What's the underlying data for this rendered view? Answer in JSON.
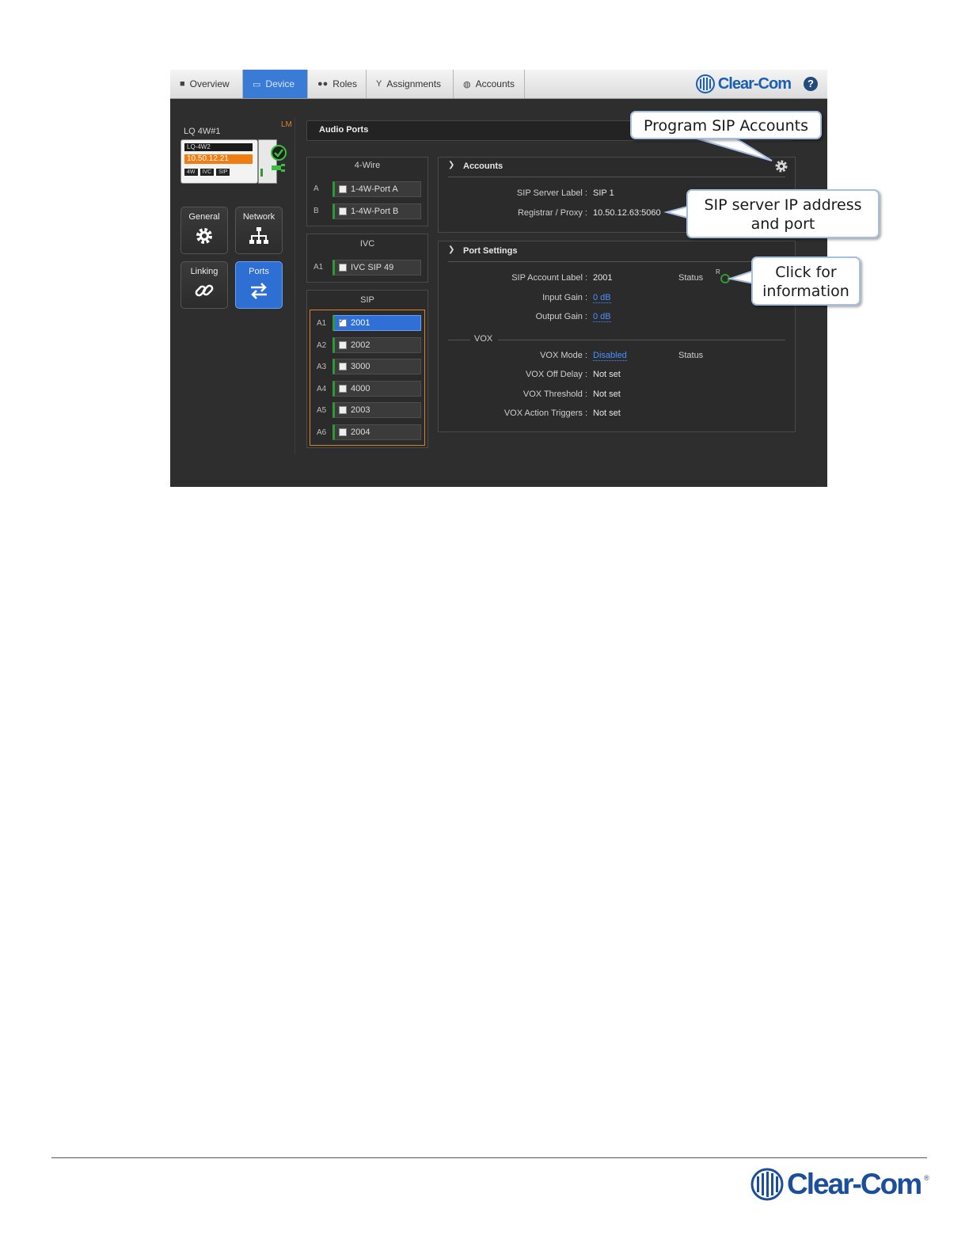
{
  "tabs": [
    {
      "label": "Overview",
      "icon": "grid-icon"
    },
    {
      "label": "Device",
      "icon": "device-icon"
    },
    {
      "label": "Roles",
      "icon": "users-icon"
    },
    {
      "label": "Assignments",
      "icon": "antenna-icon"
    },
    {
      "label": "Accounts",
      "icon": "globe-icon"
    }
  ],
  "active_tab": "Device",
  "brand": "Clear-Com",
  "help_label": "?",
  "device": {
    "name": "LQ 4W#1",
    "lm_badge": "LM",
    "card_name": "LQ-4W2",
    "ip": "10.50.12.21",
    "chips": [
      "4W",
      "IVC",
      "SIP"
    ]
  },
  "side_buttons": [
    {
      "label": "General",
      "icon": "gear-icon"
    },
    {
      "label": "Network",
      "icon": "network-icon"
    },
    {
      "label": "Linking",
      "icon": "link-icon"
    },
    {
      "label": "Ports",
      "icon": "swap-arrows-icon"
    }
  ],
  "audio_ports": {
    "title": "Audio Ports",
    "groups": [
      {
        "title": "4-Wire",
        "ports": [
          {
            "id": "A",
            "label": "1-4W-Port A",
            "selected": false
          },
          {
            "id": "B",
            "label": "1-4W-Port B",
            "selected": false
          }
        ]
      },
      {
        "title": "IVC",
        "ports": [
          {
            "id": "A1",
            "label": "IVC SIP 49",
            "selected": false
          }
        ]
      },
      {
        "title": "SIP",
        "ports": [
          {
            "id": "A1",
            "label": "2001",
            "selected": true
          },
          {
            "id": "A2",
            "label": "2002",
            "selected": false
          },
          {
            "id": "A3",
            "label": "3000",
            "selected": false
          },
          {
            "id": "A4",
            "label": "4000",
            "selected": false
          },
          {
            "id": "A5",
            "label": "2003",
            "selected": false
          },
          {
            "id": "A6",
            "label": "2004",
            "selected": false
          }
        ]
      }
    ]
  },
  "accounts": {
    "header": "Accounts",
    "server_label_key": "SIP Server Label :",
    "server_label_value": "SIP 1",
    "registrar_key": "Registrar / Proxy :",
    "registrar_value": "10.50.12.63:5060"
  },
  "port_settings": {
    "header": "Port Settings",
    "account_label_key": "SIP Account Label :",
    "account_label_value": "2001",
    "status_label": "Status",
    "status_r": "R",
    "input_gain_key": "Input Gain :",
    "input_gain_value": "0 dB",
    "output_gain_key": "Output Gain :",
    "output_gain_value": "0 dB",
    "vox_title": "VOX",
    "vox_mode_key": "VOX Mode :",
    "vox_mode_value": "Disabled",
    "vox_status_label": "Status",
    "vox_off_delay_key": "VOX Off Delay :",
    "vox_off_delay_value": "Not set",
    "vox_threshold_key": "VOX Threshold :",
    "vox_threshold_value": "Not set",
    "vox_triggers_key": "VOX Action Triggers :",
    "vox_triggers_value": "Not set"
  },
  "callouts": {
    "program": "Program SIP Accounts",
    "server_line1": "SIP server IP address",
    "server_line2": "and port",
    "click_line1": "Click for",
    "click_line2": "information"
  },
  "colors": {
    "accent_blue": "#3a7bd5",
    "link_blue": "#4a90ff",
    "ip_orange": "#f07d12",
    "status_green": "#2d9a33",
    "sip_border": "#d9822b"
  },
  "footer_brand": "Clear-Com",
  "footer_reg": "®"
}
